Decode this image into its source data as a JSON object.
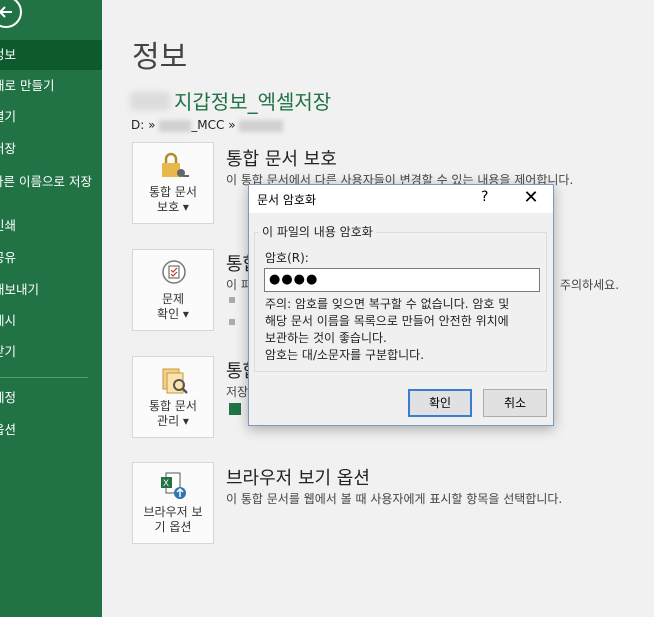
{
  "sidebar": {
    "items": [
      {
        "label": "정보"
      },
      {
        "label": "새로 만들기"
      },
      {
        "label": "열기"
      },
      {
        "label": "저장"
      },
      {
        "label": "다른 이름으로 저장"
      },
      {
        "label": "인쇄"
      },
      {
        "label": "공유"
      },
      {
        "label": "내보내기"
      },
      {
        "label": "게시"
      },
      {
        "label": "닫기"
      },
      {
        "label": "계정"
      },
      {
        "label": "옵션"
      }
    ]
  },
  "main": {
    "page_title": "정보",
    "doc_title": "지갑정보_엑셀저장",
    "path_prefix": "D: »",
    "path_mid": "_MCC »",
    "sections": [
      {
        "tile_line1": "통합 문서",
        "tile_line2": "보호 ▾",
        "title": "통합 문서 보호",
        "desc": "이 통합 문서에서 다른 사용자들이 변경할 수 있는 내용을 제어합니다."
      },
      {
        "tile_line1": "문제",
        "tile_line2": "확인 ▾",
        "title": "통합",
        "desc": "이 파",
        "desc_tail": "주의하세요."
      },
      {
        "tile_line1": "통합 문서",
        "tile_line2": "관리 ▾",
        "title": "통합",
        "desc": "저장"
      },
      {
        "tile_line1": "브라우저 보",
        "tile_line2": "기 옵션",
        "title": "브라우저 보기 옵션",
        "desc": "이 통합 문서를 웹에서 볼 때 사용자에게 표시할 항목을 선택합니다."
      }
    ]
  },
  "dialog": {
    "title": "문서 암호화",
    "help": "?",
    "close": "✕",
    "group_title": "이 파일의 내용 암호화",
    "password_label": "암호(R):",
    "password_value": "●●●●",
    "note_lines": [
      "주의: 암호를 잊으면 복구할 수 없습니다. 암호 및",
      "해당 문서 이름을 목록으로 만들어 안전한 위치에",
      "보관하는 것이 좋습니다.",
      "암호는 대/소문자를 구분합니다."
    ],
    "ok_label": "확인",
    "cancel_label": "취소"
  },
  "colors": {
    "accent": "#217346",
    "accent_dark": "#0d5a2e",
    "dialog_focus": "#3a7bd5"
  }
}
